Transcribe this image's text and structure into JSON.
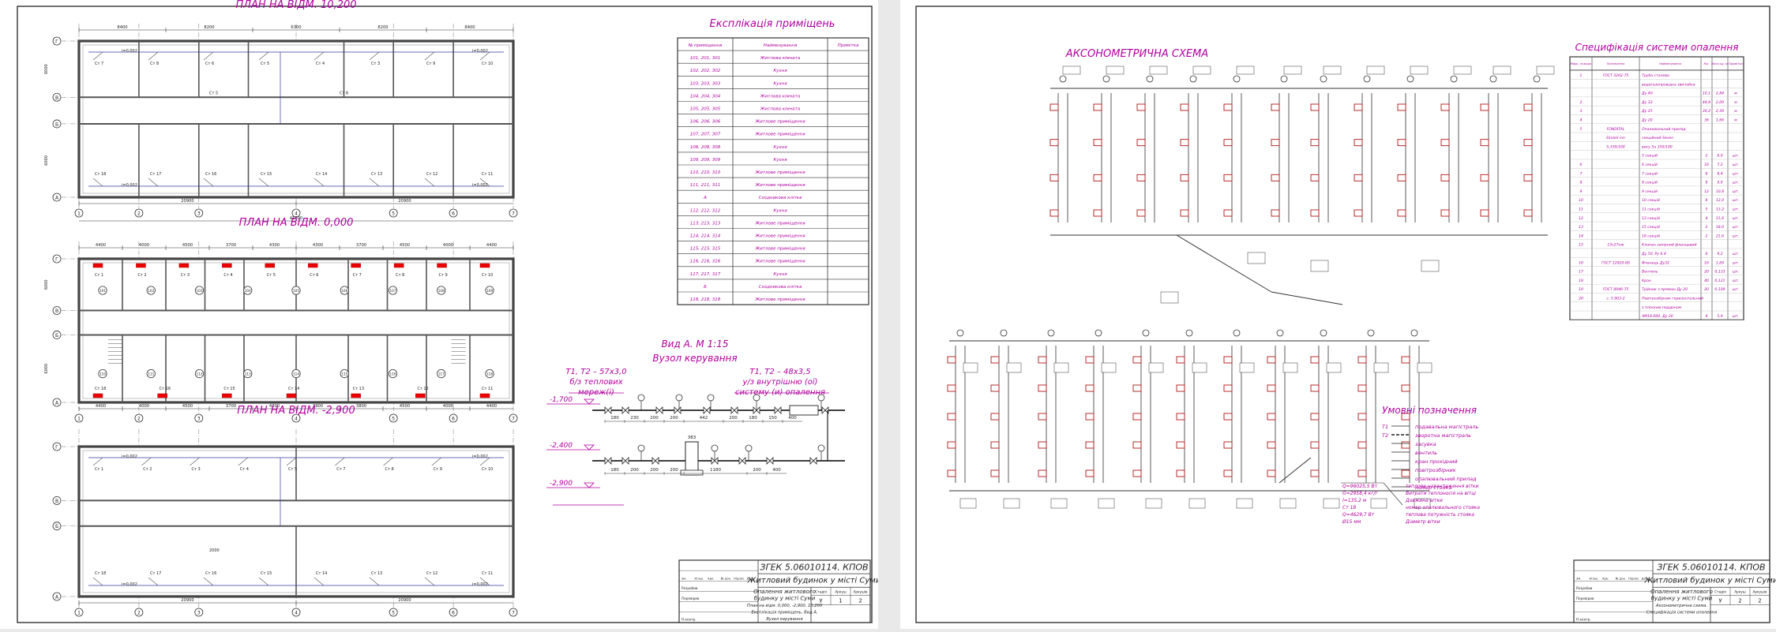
{
  "sheet1": {
    "plans": [
      {
        "title": "ПЛАН НА ВІДМ. 10,200",
        "dims_top": [
          "8400",
          "8200",
          "6300",
          "8200",
          "8400"
        ],
        "total": "41800",
        "dims_bottom": [
          "20900",
          "20900"
        ],
        "axes": [
          "1",
          "2",
          "3",
          "4",
          "5",
          "6",
          "7"
        ],
        "rows": [
          "Г",
          "В",
          "Б",
          "А"
        ],
        "side_dims": [
          "6000",
          "6000"
        ],
        "slopes": [
          "i=0,002",
          "i=0,002",
          "i=0,002",
          "i=0,002"
        ],
        "radiators_top": [
          "Ст 7",
          "Ст 8",
          "Ст 6",
          "Ст 5",
          "Ст 4",
          "Ст 3",
          "Ст 9",
          "Ст 10"
        ],
        "radiators_mid": [
          "Ст 5",
          "Ст 6"
        ],
        "radiators_bottom": [
          "Ст 18",
          "Ст 17",
          "Ст 16",
          "Ст 15",
          "Ст 14",
          "Ст 13",
          "Ст 12",
          "Ст 11"
        ]
      },
      {
        "title": "ПЛАН НА ВІДМ. 0,000",
        "dims_top": [
          "4400",
          "4000",
          "4500",
          "3700",
          "4300",
          "4300",
          "3700",
          "4500",
          "4000",
          "4400"
        ],
        "dims_bottom": [
          "4400",
          "4000",
          "4500",
          "3700",
          "4300",
          "3900",
          "3800",
          "4500",
          "4000",
          "4400"
        ],
        "axes": [
          "1",
          "2",
          "3",
          "4",
          "5",
          "6",
          "7"
        ],
        "rows": [
          "Г",
          "В",
          "Б",
          "А"
        ],
        "side_dims": [
          "6000",
          "6000"
        ],
        "radiators_top": [
          "Ст 1",
          "Ст 2",
          "Ст 3",
          "Ст 4",
          "Ст 5",
          "Ст 6",
          "Ст 7",
          "Ст 8",
          "Ст 9",
          "Ст 10"
        ],
        "radiators_bottom": [
          "Ст 18",
          "Ст 16",
          "Ст 15",
          "Ст 14",
          "Ст 13",
          "Ст 12",
          "Ст 11"
        ],
        "rooms": [
          "101",
          "102",
          "103",
          "104",
          "105",
          "106",
          "107",
          "108",
          "109",
          "110",
          "111",
          "112",
          "113",
          "114",
          "115",
          "116",
          "117",
          "118"
        ]
      },
      {
        "title": "ПЛАН НА ВІДМ. -2,900",
        "dims_bottom": [
          "20900",
          "20900"
        ],
        "axes": [
          "1",
          "2",
          "3",
          "4",
          "5",
          "6",
          "7"
        ],
        "rows": [
          "Г",
          "В",
          "Б",
          "А"
        ],
        "slopes": [
          "i=0,002",
          "i=0,002",
          "i=0,002",
          "i=0,002"
        ],
        "radiators_top": [
          "Ст 1",
          "Ст 2",
          "Ст 3",
          "Ст 4",
          "Ст 5",
          "Ст 7",
          "Ст 8",
          "Ст 9",
          "Ст 10"
        ],
        "radiators_bottom": [
          "Ст 18",
          "Ст 17",
          "Ст 16",
          "Ст 15",
          "Ст 14",
          "Ст 13",
          "Ст 12",
          "Ст 11"
        ],
        "dim_2000": "2000"
      }
    ],
    "explication": {
      "title": "Експлікація приміщень",
      "headers": [
        "№ приміщення",
        "Найменування",
        "Примітка"
      ],
      "rows": [
        [
          "101, 201, 301",
          "Житлова кімната"
        ],
        [
          "102, 202, 302",
          "Кухня"
        ],
        [
          "103, 203, 303",
          "Кухня"
        ],
        [
          "104, 204, 304",
          "Житлова кімната"
        ],
        [
          "105, 205, 305",
          "Житлова кімната"
        ],
        [
          "106, 206, 306",
          "Житлове приміщення"
        ],
        [
          "107, 207, 307",
          "Житлове приміщення"
        ],
        [
          "108, 208, 308",
          "Кухня"
        ],
        [
          "109, 209, 309",
          "Кухня"
        ],
        [
          "110, 210, 310",
          "Житлове приміщення"
        ],
        [
          "111, 211, 311",
          "Житлове приміщення"
        ],
        [
          "А",
          "Сходникова клітка"
        ],
        [
          "112, 212, 312",
          "Кухня"
        ],
        [
          "113, 213, 313",
          "Житлове приміщення"
        ],
        [
          "114, 214, 314",
          "Житлове приміщення"
        ],
        [
          "115, 215, 315",
          "Житлове приміщення"
        ],
        [
          "116, 216, 316",
          "Житлове приміщення"
        ],
        [
          "117, 217, 317",
          "Кухня"
        ],
        [
          "Б",
          "Сходникова клітка"
        ],
        [
          "118, 218, 318",
          "Житлове приміщення"
        ]
      ]
    },
    "vid": {
      "title1": "Вид А. М 1:15",
      "title2": "Вузол керування",
      "note_left": [
        "Т1, Т2 – 57х3,0",
        "б/з теплових",
        "мереж(і)"
      ],
      "note_right": [
        "Т1, Т2 – 48х3,5",
        "у/з внутрішню (ої)",
        "систему (и) опалення"
      ],
      "levels": [
        "-1,700",
        "-2,400",
        "-2,900"
      ],
      "dims_upper": [
        "180",
        "230",
        "200",
        "200",
        "442",
        "200",
        "180",
        "150",
        "400"
      ],
      "dims_lower": [
        "180",
        "200",
        "200",
        "200",
        "1180",
        "200",
        "400"
      ],
      "dim_383": "383"
    },
    "stamp": {
      "code": "ЗГЕК 5.06010114.  КПОВ",
      "name": "Житловий будинок у місті Суми",
      "desc1": "Опалення житлового",
      "desc2": "будинку у місті Суми",
      "desc3": "План на відм. 0,000, -2,900, 10,200",
      "desc4": "Експлікація приміщень, Вид А.",
      "desc5": "Вузол керування",
      "stage": "У",
      "sheet": "1",
      "sheets": "2",
      "col_headers": [
        "Зм.",
        "Кільк.",
        "Арк.",
        "№ док.",
        "Підпис",
        "Дата"
      ],
      "roles": [
        "Розробив",
        "Перевірив",
        "",
        "Н.контр."
      ],
      "stage_hdr": [
        "Стадія",
        "Аркуш",
        "Аркушів"
      ]
    }
  },
  "sheet2": {
    "axo_title": "АКСОНОМЕТРИЧНА СХЕМА",
    "spec": {
      "title": "Специфікація системи опалення",
      "headers": [
        "Марк. позиція",
        "Позначення",
        "Найменування",
        "Кіл.",
        "Маса од. кг",
        "Примітка"
      ],
      "rows": [
        [
          "1",
          "ГОСТ 3262-75",
          "Труба сталева",
          "",
          "",
          ""
        ],
        [
          "",
          "",
          "водогазопровідна звичайна",
          "",
          "",
          ""
        ],
        [
          "",
          "",
          "Ду 40",
          "10,1",
          "2,84",
          "м"
        ],
        [
          "2",
          "",
          "Ду 32",
          "44,8",
          "2,09",
          "м"
        ],
        [
          "3",
          "",
          "Ду 25",
          "30,2",
          "2,39",
          "м"
        ],
        [
          "4",
          "",
          "Ду 20",
          "36",
          "1,66",
          "м"
        ],
        [
          "5",
          "FONDITAL",
          "Опалювальний прилад",
          "",
          "",
          ""
        ],
        [
          "",
          "Ekoleil inn",
          "секційний Seven",
          "",
          "",
          ""
        ],
        [
          "",
          "S.350/100",
          "вису 5а 350/100",
          "",
          "",
          ""
        ],
        [
          "",
          "",
          "5 секцій",
          "2",
          "6,0",
          "шт."
        ],
        [
          "6",
          "",
          "6 секцій",
          "16",
          "7,2",
          "шт."
        ],
        [
          "7",
          "",
          "7 секцій",
          "8",
          "8,4",
          "шт."
        ],
        [
          "8",
          "",
          "8 секцій",
          "8",
          "9,6",
          "шт."
        ],
        [
          "9",
          "",
          "9 секцій",
          "12",
          "10,8",
          "шт."
        ],
        [
          "10",
          "",
          "10 секцій",
          "8",
          "12,0",
          "шт."
        ],
        [
          "11",
          "",
          "11 секцій",
          "5",
          "13,2",
          "шт."
        ],
        [
          "12",
          "",
          "13 секцій",
          "4",
          "15,6",
          "шт."
        ],
        [
          "13",
          "",
          "15 секцій",
          "2",
          "18,0",
          "шт."
        ],
        [
          "14",
          "",
          "18 секцій",
          "2",
          "21,6",
          "шт."
        ],
        [
          "15",
          "15с27нж",
          "Клапан запірний фланцевий",
          "",
          "",
          ""
        ],
        [
          "",
          "",
          "Ду 50, Ру 6,4",
          "8",
          "9,2",
          "шт."
        ],
        [
          "16",
          "ГОСТ 12820-80",
          "Фланець Ду32",
          "16",
          "1,69",
          "шт."
        ],
        [
          "17",
          "",
          "Вентиль",
          "20",
          "0,133",
          "шт."
        ],
        [
          "18",
          "",
          "Кран",
          "40",
          "0,121",
          "шт."
        ],
        [
          "19",
          "ГОСТ 8946-75",
          "Трійник з прямою Ду 20",
          "20",
          "0,109",
          "шт."
        ],
        [
          "20",
          "с. 5.903-2",
          "Повітрозбірник горизонтальний",
          "",
          "",
          ""
        ],
        [
          "",
          "",
          "з плоским поддоном",
          "",
          "",
          ""
        ],
        [
          "",
          "",
          "АМ18.000, Ду 20",
          "4",
          "5,9",
          "шт."
        ]
      ]
    },
    "legend": {
      "title": "Умовні позначення",
      "items": [
        [
          "Т1",
          "подавальна магістраль"
        ],
        [
          "Т2",
          "зворотна магістраль"
        ],
        [
          "",
          "засувка"
        ],
        [
          "",
          "вентиль"
        ],
        [
          "",
          "кран прохідний"
        ],
        [
          "",
          "повітрозбірник"
        ],
        [
          "",
          "опалювальний прилад"
        ],
        [
          "",
          "номер стояка"
        ]
      ],
      "formula_left": [
        "Q=96025,5 Вт",
        "G=2958,4 кг/г",
        "l=135,2 м",
        "Ст 18",
        "Q=4629,7 Вт",
        "Ø15 мм"
      ],
      "formula_right": [
        "теплове навантаження вітки",
        "Витрати теплоносія на вітці",
        "Довжина вітки",
        "номер опалювального стояка",
        "теплова потужність стояка",
        "Діаметр вітки"
      ]
    },
    "stamp": {
      "code": "ЗГЕК 5.06010114.  КПОВ",
      "name": "Житловий будинок у місті Суми",
      "desc1": "Опалення житлового",
      "desc2": "будинку у місті Суми",
      "desc3": "Аксонометрична схема.",
      "desc4": "Специфікація системи опалення",
      "stage": "У",
      "sheet": "2",
      "sheets": "2",
      "col_headers": [
        "Зм.",
        "Кільк.",
        "Арк.",
        "№ док.",
        "Підпис",
        "Дата"
      ],
      "roles": [
        "Розробив",
        "Перевірив",
        "",
        "Н.контр."
      ],
      "stage_hdr": [
        "Стадія",
        "Аркуш",
        "Аркушів"
      ]
    }
  }
}
